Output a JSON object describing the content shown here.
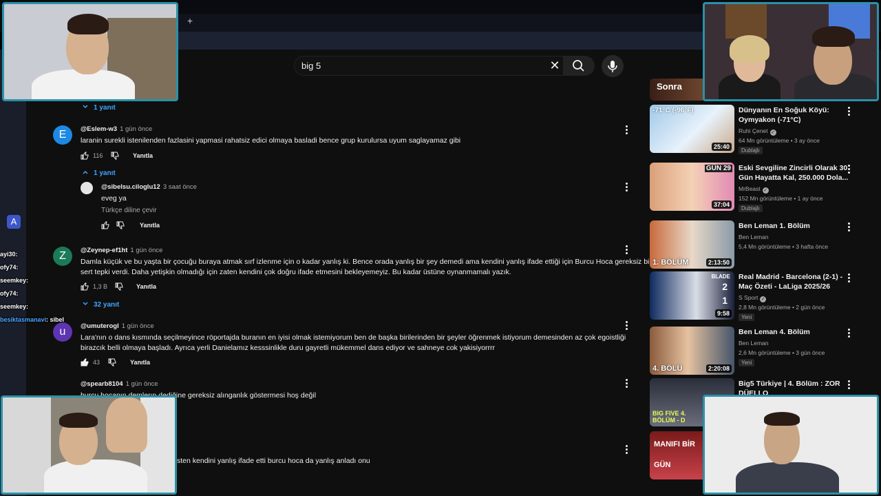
{
  "search": {
    "value": "big 5"
  },
  "comments": [
    {
      "replies_toggle": "1 yanıt"
    },
    {
      "avatar_letter": "E",
      "avatar_color": "#1e88e5",
      "author": "@Eslem-w3",
      "date": "1 gün önce",
      "text": "laranin surekli istenilenden fazlasini yapmasi rahatsiz edici olmaya basladi bence grup kurulursa uyum saglayamaz gibi",
      "likes": "116",
      "reply_label": "Yanıtla",
      "replies_toggle": "1 yanıt"
    },
    {
      "author": "@sibelsu.ciloglu12",
      "date": "3 saat önce",
      "text": "eveg ya",
      "translate": "Türkçe diline çevir",
      "reply_label": "Yanıtla"
    },
    {
      "avatar_letter": "Z",
      "avatar_color": "#1b7a57",
      "author": "@Zeynep-ef1ht",
      "date": "1 gün önce",
      "text_line1": "Damla küçük ve bu yaşta bir çocuğu buraya atmak sırf izlenme için o kadar yanlış ki. Bence orada yanlış bir şey demedi ama kendini yanlış ifade ettiği için Burcu Hoca gereksiz bi",
      "text_line2": "sert tepki verdi. Daha yetişkin olmadığı için zaten kendini çok doğru ifade etmesini bekleyemeyiz. Bu kadar üstüne oynanmamalı yazık.",
      "likes": "1,3 B",
      "reply_label": "Yanıtla",
      "replies_toggle": "32 yanıt"
    },
    {
      "avatar_letter": "u",
      "avatar_color": "#5e35b1",
      "author": "@umuterogl",
      "date": "1 gün önce",
      "text_line1": "Lara'nın o dans kısmında seçilmeyince röportajda buranın en iyisi olmak istemiyorum ben de başka birilerinden bir şeyler öğrenmek istiyorum demesinden az çok egoistliği",
      "text_line2": "birazcık belli olmaya başladı. Ayrıca yerli Danielamız kesssinlikle duru gayretli mükemmel dans ediyor ve sahneye cok yakisiyorrrr",
      "likes": "43",
      "reply_label": "Yanıtla"
    },
    {
      "author": "@spearb8104",
      "date": "1 gün önce",
      "text": "burcu hocanın demlerın dediğine gereksiz alınganlık göstermesi hoş değil"
    },
    {
      "text": "sten kendini yanlış ifade etti burcu hoca da yanlış anladı onu"
    }
  ],
  "related": [
    {
      "title": "Dünyanın En Soğuk Köyü: Oymyakon (-71°C)",
      "channel": "Ruhi Çenet",
      "meta": "64 Mn görüntüleme • 3 ay önce",
      "duration": "25:40",
      "tag": "Dublajlı",
      "thumb_text": "-71°C (-96°F)"
    },
    {
      "title": "Eski Sevgiline Zincirli Olarak 30 Gün Hayatta Kal, 250.000 Dola...",
      "channel": "MrBeast",
      "meta": "152 Mn görüntüleme • 1 ay önce",
      "duration": "37:04",
      "tag": "Dublajlı",
      "thumb_text": "GÜN 29"
    },
    {
      "title": "Ben Leman 1. Bölüm",
      "channel": "Ben Leman",
      "meta": "5,4 Mn görüntüleme • 3 hafta önce",
      "duration": "2:13:50",
      "thumb_text": "1. BÖLÜM"
    },
    {
      "title": "Real Madrid - Barcelona (2-1) - Maç Özeti - LaLiga 2025/26",
      "channel": "S Sport",
      "meta": "2,8 Mn görüntüleme • 2 gün önce",
      "duration": "9:58",
      "tag": "Yeni",
      "thumb_text": "BLADE",
      "score_home": "2",
      "score_away": "1"
    },
    {
      "title": "Ben Leman 4. Bölüm",
      "channel": "Ben Leman",
      "meta": "2,6 Mn görüntüleme • 3 gün önce",
      "duration": "2:20:08",
      "tag": "Yeni",
      "thumb_text": "4. BÖLÜ"
    },
    {
      "title": "Big5 Türkiye | 4. Bölüm : ZOR DÜELLO",
      "thumb_text": "BIG FIVE 4. BÖLÜM - D"
    },
    {
      "thumb_text": "MANIFI BİR GÜN"
    },
    {
      "thumb_text": "Sonra"
    }
  ],
  "chat": [
    {
      "user": "ayi30",
      "msg": ""
    },
    {
      "user": "ofy74",
      "msg": ""
    },
    {
      "user": "seemkey",
      "msg": ""
    },
    {
      "user": "ofy74",
      "msg": ""
    },
    {
      "user": "seemkey",
      "msg": ""
    },
    {
      "user": "besiktasmanavi",
      "msg": "sibel"
    }
  ],
  "colors": {
    "accent": "#3ea6ff",
    "cam_border": "#2a92a8",
    "bg": "#0f0f0f"
  }
}
